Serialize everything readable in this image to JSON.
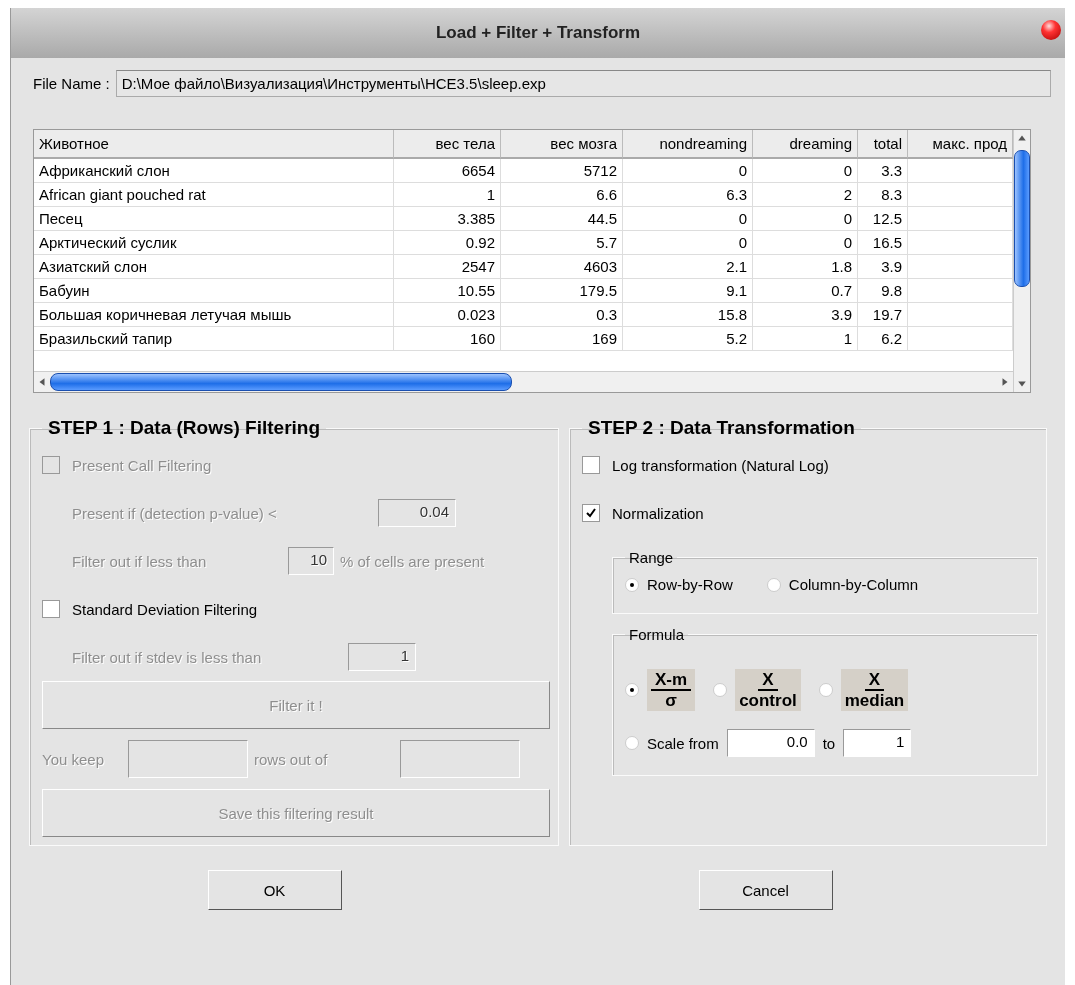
{
  "window": {
    "title": "Load + Filter + Transform"
  },
  "file_name": {
    "label": "File Name :",
    "value": "D:\\Мое файло\\Визуализация\\Инструменты\\HCE3.5\\sleep.exp"
  },
  "table": {
    "columns": [
      "Животное",
      "вес тела",
      "вес мозга",
      "nondreaming",
      "dreaming",
      "total",
      "макс. прод"
    ],
    "rows": [
      [
        "Африканский слон",
        "6654",
        "5712",
        "0",
        "0",
        "3.3",
        ""
      ],
      [
        "African giant pouched rat",
        "1",
        "6.6",
        "6.3",
        "2",
        "8.3",
        ""
      ],
      [
        "Песец",
        "3.385",
        "44.5",
        "0",
        "0",
        "12.5",
        ""
      ],
      [
        "Арктический суслик",
        "0.92",
        "5.7",
        "0",
        "0",
        "16.5",
        ""
      ],
      [
        "Азиатский слон",
        "2547",
        "4603",
        "2.1",
        "1.8",
        "3.9",
        ""
      ],
      [
        "Бабуин",
        "10.55",
        "179.5",
        "9.1",
        "0.7",
        "9.8",
        ""
      ],
      [
        "Большая коричневая летучая мышь",
        "0.023",
        "0.3",
        "15.8",
        "3.9",
        "19.7",
        ""
      ],
      [
        "Бразильский тапир",
        "160",
        "169",
        "5.2",
        "1",
        "6.2",
        ""
      ]
    ]
  },
  "step1": {
    "title": "STEP 1 : Data (Rows) Filtering",
    "present_call": {
      "label": "Present Call Filtering",
      "checked": false,
      "disabled": true
    },
    "pvalue": {
      "label": "Present if (detection p-value) <",
      "value": "0.04",
      "disabled": true
    },
    "percent": {
      "label": "Filter out if less than",
      "value": "10",
      "suffix": "% of cells are present",
      "disabled": true
    },
    "sd": {
      "label": "Standard Deviation Filtering",
      "checked": false,
      "disabled": false
    },
    "stdev": {
      "label": "Filter out if stdev is less than",
      "value": "1",
      "disabled": true
    },
    "filter_button": {
      "label": "Filter it !",
      "disabled": true
    },
    "keep": {
      "label": "You keep",
      "middle": "rows out of",
      "disabled": true
    },
    "save_button": {
      "label": "Save this filtering result",
      "disabled": true
    }
  },
  "step2": {
    "title": "STEP 2 : Data Transformation",
    "log": {
      "label": "Log transformation (Natural Log)",
      "checked": false
    },
    "normalization": {
      "label": "Normalization",
      "checked": true
    },
    "range": {
      "title": "Range",
      "options": [
        {
          "label": "Row-by-Row",
          "selected": true
        },
        {
          "label": "Column-by-Column",
          "selected": false
        }
      ]
    },
    "formula": {
      "title": "Formula",
      "options": [
        {
          "kind": "fraction",
          "numerator": "X-m",
          "denominator": "σ",
          "selected": true
        },
        {
          "kind": "fraction",
          "numerator": "X",
          "denominator": "control",
          "selected": false
        },
        {
          "kind": "fraction",
          "numerator": "X",
          "denominator": "median",
          "selected": false
        },
        {
          "kind": "scale",
          "label": "Scale from",
          "from": "0.0",
          "to_label": "to",
          "to": "1",
          "selected": false
        }
      ]
    }
  },
  "buttons": [
    "OK",
    "Cancel"
  ]
}
